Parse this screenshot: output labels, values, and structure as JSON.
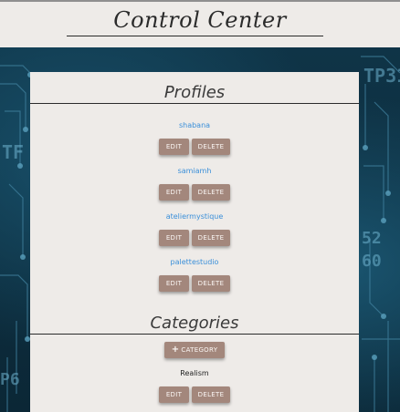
{
  "header": {
    "title": "Control Center"
  },
  "profiles": {
    "title": "Profiles",
    "items": [
      {
        "name": "shabana"
      },
      {
        "name": "samiamh"
      },
      {
        "name": "ateliermystique"
      },
      {
        "name": "palettestudio"
      }
    ]
  },
  "categories": {
    "title": "Categories",
    "add_label": "CATEGORY",
    "items": [
      {
        "name": "Realism"
      }
    ]
  },
  "buttons": {
    "edit_label": "EDIT",
    "delete_label": "DELETE"
  },
  "colors": {
    "button_bg": "#a3877c",
    "link": "#3a8fd9",
    "card_bg": "#eeebe8",
    "background": "#0c2a3a"
  }
}
